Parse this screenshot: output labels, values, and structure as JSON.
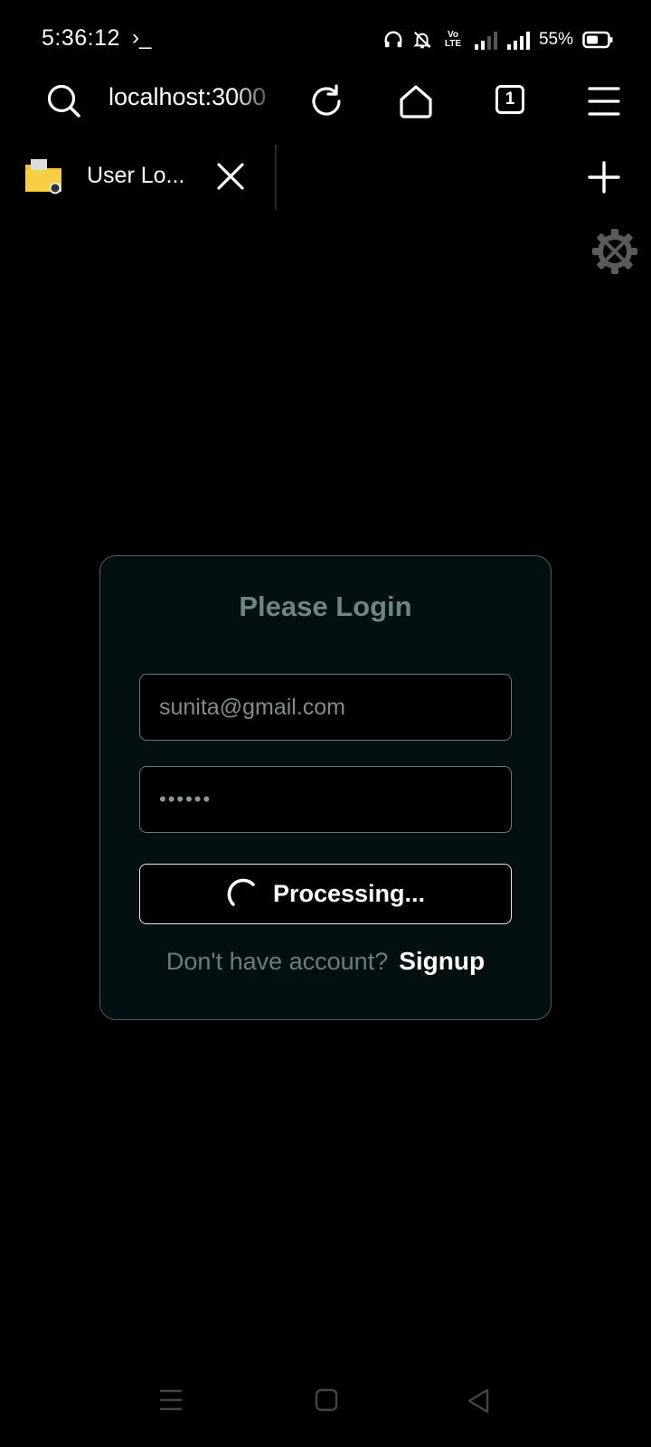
{
  "status_bar": {
    "time": "5:36:12",
    "terminal_glyph": "›_",
    "network_label": "Vo LTE",
    "battery_percent": "55%",
    "battery_level": 0.55
  },
  "browser": {
    "url": "localhost:3000",
    "tab_count": "1",
    "tab": {
      "title": "User Lo..."
    }
  },
  "login": {
    "title": "Please Login",
    "email_value": "sunita@gmail.com",
    "password_masked": "••••••",
    "button_label": "Processing...",
    "footer_text": "Don't have account?",
    "signup_link": "Signup"
  },
  "colors": {
    "card_bg": "#030f11",
    "title": "#6f8584",
    "footer_text": "#6a7c7b",
    "folder_icon": "#f4c430"
  }
}
